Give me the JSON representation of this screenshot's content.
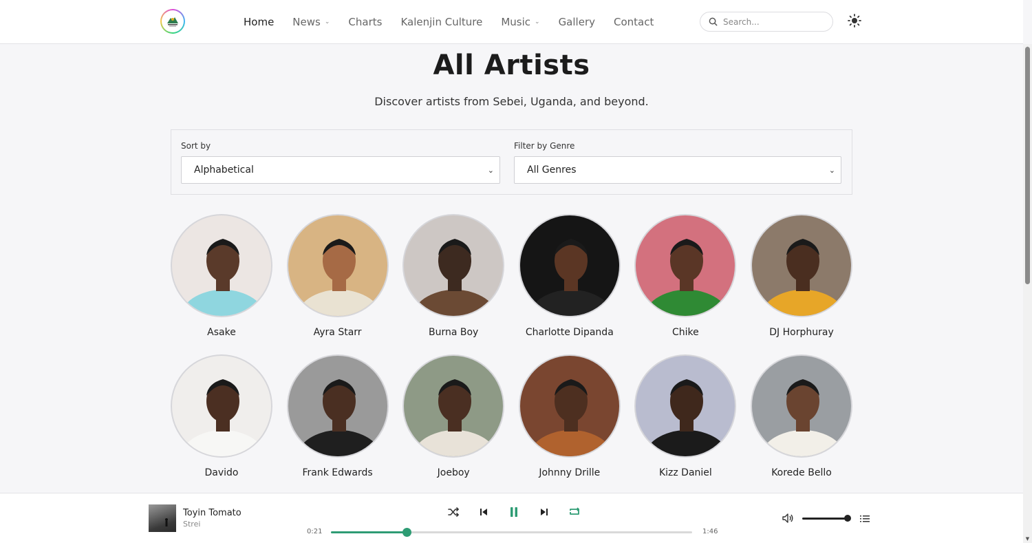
{
  "header": {
    "nav": [
      {
        "label": "Home",
        "active": true,
        "dropdown": false
      },
      {
        "label": "News",
        "active": false,
        "dropdown": true
      },
      {
        "label": "Charts",
        "active": false,
        "dropdown": false
      },
      {
        "label": "Kalenjin Culture",
        "active": false,
        "dropdown": false
      },
      {
        "label": "Music",
        "active": false,
        "dropdown": true
      },
      {
        "label": "Gallery",
        "active": false,
        "dropdown": false
      },
      {
        "label": "Contact",
        "active": false,
        "dropdown": false
      }
    ],
    "search_placeholder": "Search...",
    "theme_icon": "sun-icon"
  },
  "page": {
    "title": "All Artists",
    "subtitle": "Discover artists from Sebei, Uganda, and beyond."
  },
  "filters": {
    "sort_label": "Sort by",
    "sort_value": "Alphabetical",
    "genre_label": "Filter by Genre",
    "genre_value": "All Genres"
  },
  "artists": [
    {
      "name": "Asake",
      "bg": "#ece6e3",
      "skin": "#5a3a2a",
      "top": "#8fd6df"
    },
    {
      "name": "Ayra Starr",
      "bg": "#d8b483",
      "skin": "#a66a45",
      "top": "#e9e2d2"
    },
    {
      "name": "Burna Boy",
      "bg": "#cdc7c4",
      "skin": "#3d2a20",
      "top": "#6b4a34"
    },
    {
      "name": "Charlotte Dipanda",
      "bg": "#151515",
      "skin": "#5b3624",
      "top": "#222222"
    },
    {
      "name": "Chike",
      "bg": "#d3717e",
      "skin": "#5a3626",
      "top": "#2f8a34"
    },
    {
      "name": "DJ Horphuray",
      "bg": "#8c7a6a",
      "skin": "#4a2e20",
      "top": "#e7a628"
    },
    {
      "name": "Davido",
      "bg": "#f0eeec",
      "skin": "#4b2f22",
      "top": "#f7f7f5"
    },
    {
      "name": "Frank Edwards",
      "bg": "#9a9a9a",
      "skin": "#4a2f22",
      "top": "#1f1f1f"
    },
    {
      "name": "Joeboy",
      "bg": "#8e9a86",
      "skin": "#4a2f22",
      "top": "#e8e2d8"
    },
    {
      "name": "Johnny Drille",
      "bg": "#7a4630",
      "skin": "#4d2f20",
      "top": "#b0622e"
    },
    {
      "name": "Kizz Daniel",
      "bg": "#b9bccf",
      "skin": "#3f281c",
      "top": "#1b1b1b"
    },
    {
      "name": "Korede Bello",
      "bg": "#9a9ea2",
      "skin": "#6a4430",
      "top": "#f2efe8"
    }
  ],
  "player": {
    "track_title": "Toyin Tomato",
    "track_artist": "Strei",
    "current_time": "0:21",
    "duration": "1:46",
    "progress": 0.21,
    "volume": 0.92,
    "accent": "#2e9c74",
    "controls": [
      "shuffle-icon",
      "previous-icon",
      "pause-icon",
      "next-icon",
      "repeat-icon"
    ]
  }
}
